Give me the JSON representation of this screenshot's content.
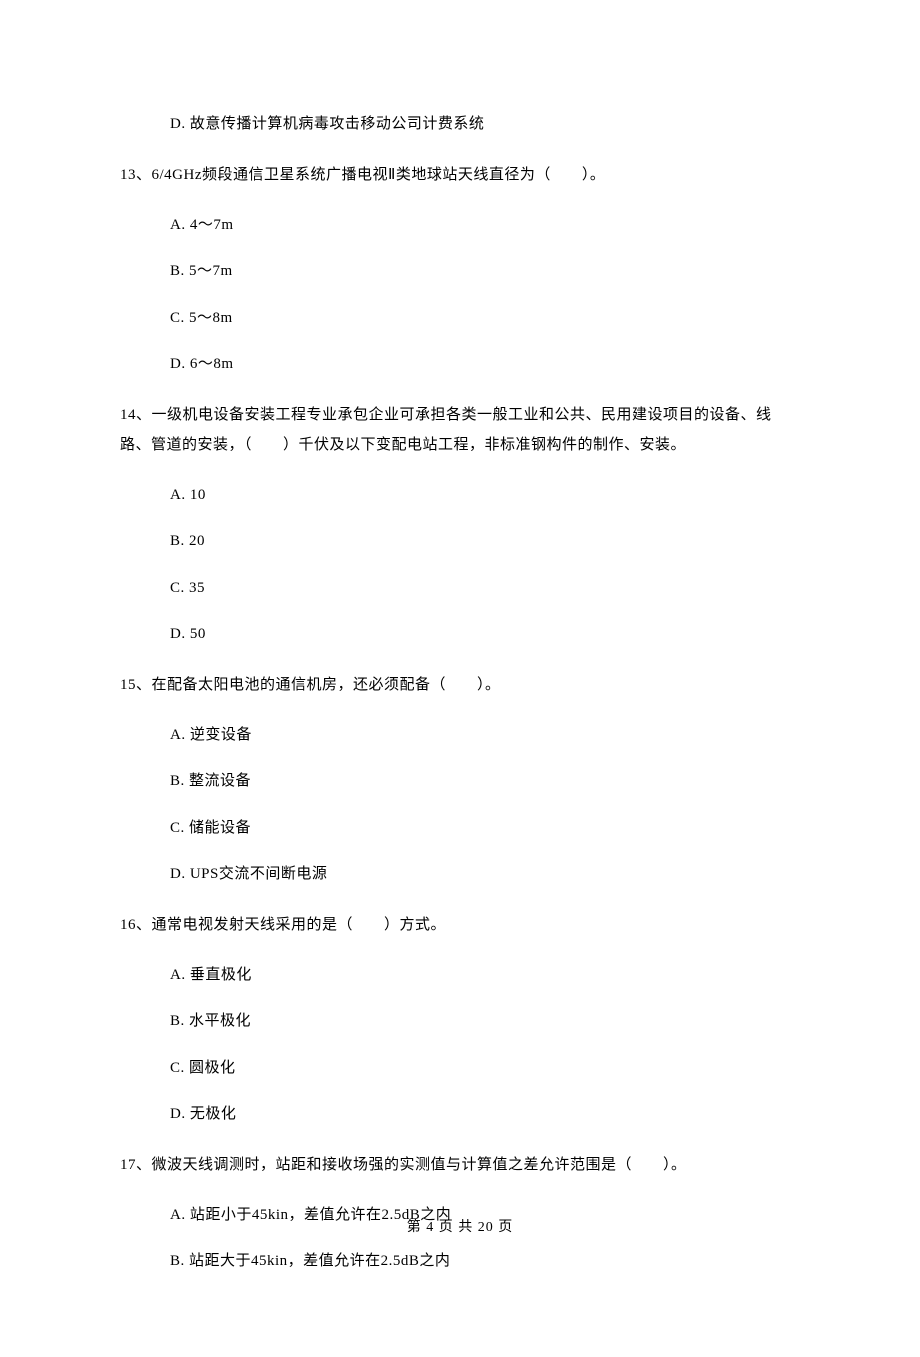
{
  "q12_opt_d": "D.  故意传播计算机病毒攻击移动公司计费系统",
  "q13_text": "13、6/4GHz频段通信卫星系统广播电视Ⅱ类地球站天线直径为（　　）。",
  "q13_opt_a": "A.  4～7m",
  "q13_opt_b": "B.  5～7m",
  "q13_opt_c": "C.  5～8m",
  "q13_opt_d": "D.  6～8m",
  "q14_text": "14、一级机电设备安装工程专业承包企业可承担各类一般工业和公共、民用建设项目的设备、线路、管道的安装，（　　）千伏及以下变配电站工程，非标准钢构件的制作、安装。",
  "q14_opt_a": "A.  10",
  "q14_opt_b": "B.  20",
  "q14_opt_c": "C.  35",
  "q14_opt_d": "D.  50",
  "q15_text": "15、在配备太阳电池的通信机房，还必须配备（　　）。",
  "q15_opt_a": "A.  逆变设备",
  "q15_opt_b": "B.  整流设备",
  "q15_opt_c": "C.  储能设备",
  "q15_opt_d": "D.  UPS交流不间断电源",
  "q16_text": "16、通常电视发射天线采用的是（　　）方式。",
  "q16_opt_a": "A.  垂直极化",
  "q16_opt_b": "B.  水平极化",
  "q16_opt_c": "C.  圆极化",
  "q16_opt_d": "D.  无极化",
  "q17_text": "17、微波天线调测时，站距和接收场强的实测值与计算值之差允许范围是（　　）。",
  "q17_opt_a": "A.  站距小于45kin，差值允许在2.5dB之内",
  "q17_opt_b": "B.  站距大于45kin，差值允许在2.5dB之内",
  "footer": "第 4 页 共 20 页"
}
